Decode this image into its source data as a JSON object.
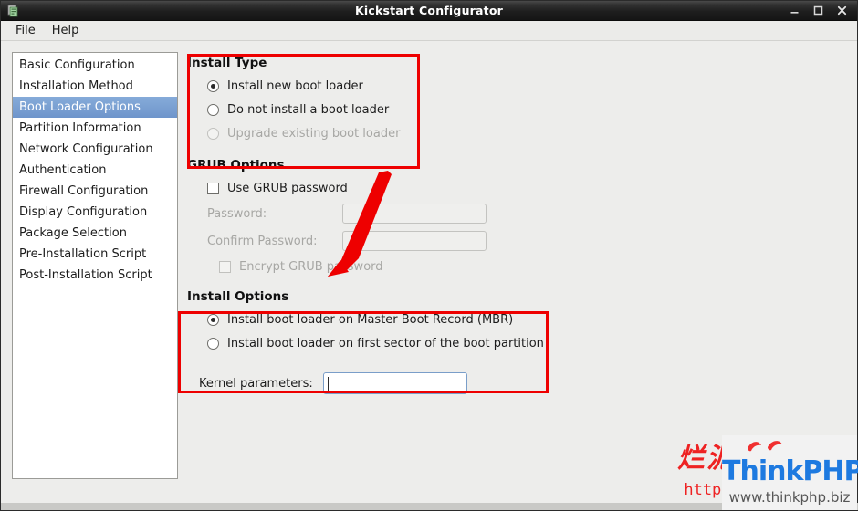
{
  "window": {
    "title": "Kickstart Configurator",
    "app_icon": "kickstart-icon",
    "controls": {
      "minimize": "minimize-icon",
      "maximize": "maximize-icon",
      "close": "close-icon"
    }
  },
  "menubar": {
    "items": [
      {
        "label": "File"
      },
      {
        "label": "Help"
      }
    ]
  },
  "sidebar": {
    "items": [
      {
        "label": "Basic Configuration",
        "selected": false
      },
      {
        "label": "Installation Method",
        "selected": false
      },
      {
        "label": "Boot Loader Options",
        "selected": true
      },
      {
        "label": "Partition Information",
        "selected": false
      },
      {
        "label": "Network Configuration",
        "selected": false
      },
      {
        "label": "Authentication",
        "selected": false
      },
      {
        "label": "Firewall Configuration",
        "selected": false
      },
      {
        "label": "Display Configuration",
        "selected": false
      },
      {
        "label": "Package Selection",
        "selected": false
      },
      {
        "label": "Pre-Installation Script",
        "selected": false
      },
      {
        "label": "Post-Installation Script",
        "selected": false
      }
    ]
  },
  "install_type": {
    "title": "Install Type",
    "options": [
      {
        "label": "Install new boot loader",
        "checked": true,
        "disabled": false
      },
      {
        "label": "Do not install a boot loader",
        "checked": false,
        "disabled": false
      },
      {
        "label": "Upgrade existing boot loader",
        "checked": false,
        "disabled": true
      }
    ]
  },
  "grub_options": {
    "title": "GRUB Options",
    "use_password": {
      "label": "Use GRUB password",
      "checked": false,
      "disabled": false
    },
    "password": {
      "label": "Password:",
      "value": "",
      "disabled": true
    },
    "confirm_password": {
      "label": "Confirm Password:",
      "value": "",
      "disabled": true
    },
    "encrypt": {
      "label": "Encrypt GRUB password",
      "checked": false,
      "disabled": true
    }
  },
  "install_options": {
    "title": "Install Options",
    "options": [
      {
        "label": "Install boot loader on Master Boot Record (MBR)",
        "checked": true
      },
      {
        "label": "Install boot loader on first sector of the boot partition",
        "checked": false
      }
    ]
  },
  "kernel": {
    "label": "Kernel parameters:",
    "value": "",
    "placeholder": ""
  },
  "annotations": {
    "color": "#ee0000",
    "boxes": [
      {
        "name": "install-type-highlight"
      },
      {
        "name": "install-options-highlight"
      }
    ],
    "arrow": {
      "name": "pointer-arrow",
      "from": "Install Type",
      "to": "Install Options"
    }
  },
  "watermark": {
    "chinese": "烂泥",
    "url": "http://",
    "brand": "ThinkPHP",
    "brand_url": "www.thinkphp.biz",
    "brand_color": "#1e7ae0",
    "accent_color": "#ee2222"
  }
}
